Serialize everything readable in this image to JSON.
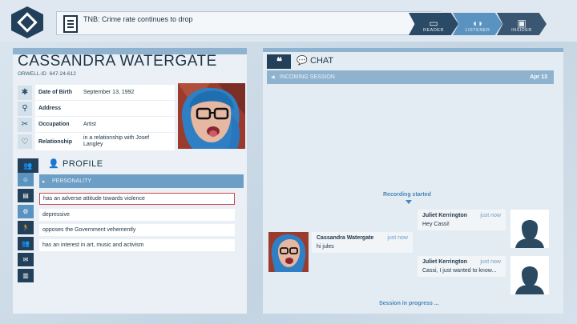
{
  "header": {
    "news": "TNB: Crime rate continues to drop",
    "modes": [
      {
        "label": "READER",
        "icon": "book-icon"
      },
      {
        "label": "LISTENER",
        "icon": "headphones-icon"
      },
      {
        "label": "INSIDER",
        "icon": "computer-icon"
      }
    ],
    "active_mode": "LISTENER"
  },
  "profile": {
    "name": "CASSANDRA WATERGATE",
    "orwell_label": "ORWELL-ID",
    "orwell_id": "647-24-612",
    "fields": [
      {
        "key": "Date of Birth",
        "value": "September 13, 1992",
        "icon": "asterisk-icon"
      },
      {
        "key": "Address",
        "value": "",
        "icon": "location-pin-icon"
      },
      {
        "key": "Occupation",
        "value": "Artist",
        "icon": "tools-icon"
      },
      {
        "key": "Relationship",
        "value": "in a relationship with Josef Langley",
        "icon": "relationship-icon"
      }
    ],
    "section_title": "PROFILE",
    "category": "PERSONALITY",
    "traits": [
      "has an adverse attitude towards violence",
      "depressive",
      "opposes the Government vehemently",
      "has an interest in art, music and activism"
    ],
    "selected_trait_index": 0
  },
  "chat": {
    "title": "CHAT",
    "session_label": "INCOMING SESSION",
    "session_date": "Apr 13",
    "recording": "Recording started",
    "messages": [
      {
        "sender": "Juliet Kerrington",
        "time": "just now",
        "text": "Hey Cassi!",
        "side": "right"
      },
      {
        "sender": "Cassandra Watergate",
        "time": "just now",
        "text": "hi jules",
        "side": "left"
      },
      {
        "sender": "Juliet Kerrington",
        "time": "just now",
        "text": "Cassi, I just wanted to know...",
        "side": "right"
      }
    ],
    "status": "Session in progress ..."
  },
  "colors": {
    "accent": "#5a93c0",
    "dark": "#23405a",
    "highlight": "#c9484a"
  }
}
